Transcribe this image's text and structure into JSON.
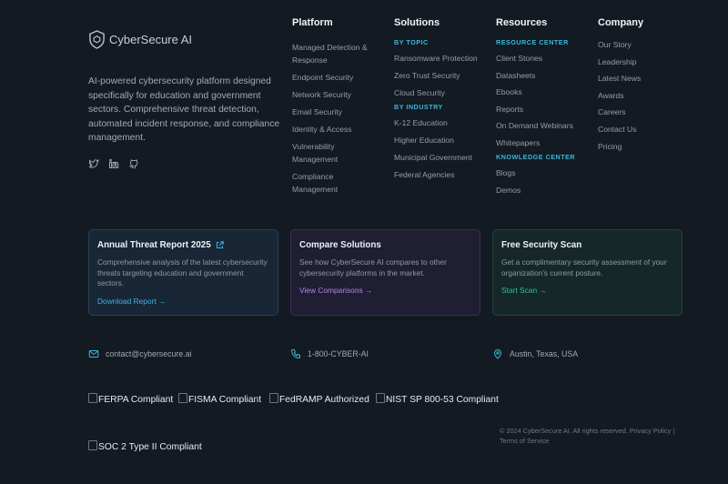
{
  "brand": {
    "name": "CyberSecure AI",
    "description": "AI-powered cybersecurity platform designed specifically for education and government sectors. Comprehensive threat detection, automated incident response, and compliance management.",
    "socials": [
      "twitter-icon",
      "linkedin-icon",
      "github-icon"
    ]
  },
  "columns": {
    "platform": {
      "heading": "Platform",
      "items": [
        "Managed Detection &",
        "Response",
        "Endpoint Security",
        "Network Security",
        "Email Security",
        "Identity & Access",
        "Vulnerability",
        "Management",
        "Compliance",
        "Management"
      ]
    },
    "solutions": {
      "heading": "Solutions",
      "topic_label": "BY TOPIC",
      "topic_items": [
        "Ransomware Protection",
        "Zero Trust Security",
        "Cloud Security"
      ],
      "industry_label": "BY INDUSTRY",
      "industry_items": [
        "K-12 Education",
        "Higher Education",
        "Municipal Government",
        "Federal Agencies"
      ]
    },
    "resources": {
      "heading": "Resources",
      "center_label": "RESOURCE CENTER",
      "center_items": [
        "Client Stories",
        "Datasheets",
        "Ebooks",
        "Reports",
        "On Demand Webinars",
        "Whitepapers"
      ],
      "knowledge_label": "KNOWLEDGE CENTER",
      "knowledge_items": [
        "Blogs",
        "Demos"
      ]
    },
    "company": {
      "heading": "Company",
      "items": [
        "Our Story",
        "Leadership",
        "Latest News",
        "Awards",
        "Careers",
        "Contact Us",
        "Pricing"
      ]
    }
  },
  "cards": [
    {
      "title": "Annual Threat Report 2025",
      "text": "Comprehensive analysis of the latest cybersecurity threats targeting education and government sectors.",
      "link": "Download Report →"
    },
    {
      "title": "Compare Solutions",
      "text": "See how CyberSecure AI compares to other cybersecurity platforms in the market.",
      "link": "View Comparisons →"
    },
    {
      "title": "Free Security Scan",
      "text": "Get a complimentary security assessment of your organization's current posture.",
      "link": "Start Scan →"
    }
  ],
  "contact": {
    "email": "contact@cybersecure.ai",
    "phone": "1-800-CYBER-AI",
    "location": "Austin, Texas, USA"
  },
  "badges": [
    "FERPA Compliant",
    "FISMA Compliant",
    "FedRAMP Authorized",
    "NIST SP 800-53 Compliant",
    "SOC 2 Type II Compliant"
  ],
  "footer": {
    "copyright": "© 2024 CyberSecure AI. All rights reserved.",
    "privacy": "Privacy Policy",
    "separator": "|",
    "terms": "Terms of Service"
  },
  "colors": {
    "background": "#131a21",
    "accent_cyan": "#3ab8d9",
    "accent_purple": "#b583e6",
    "accent_green": "#29c49a"
  }
}
